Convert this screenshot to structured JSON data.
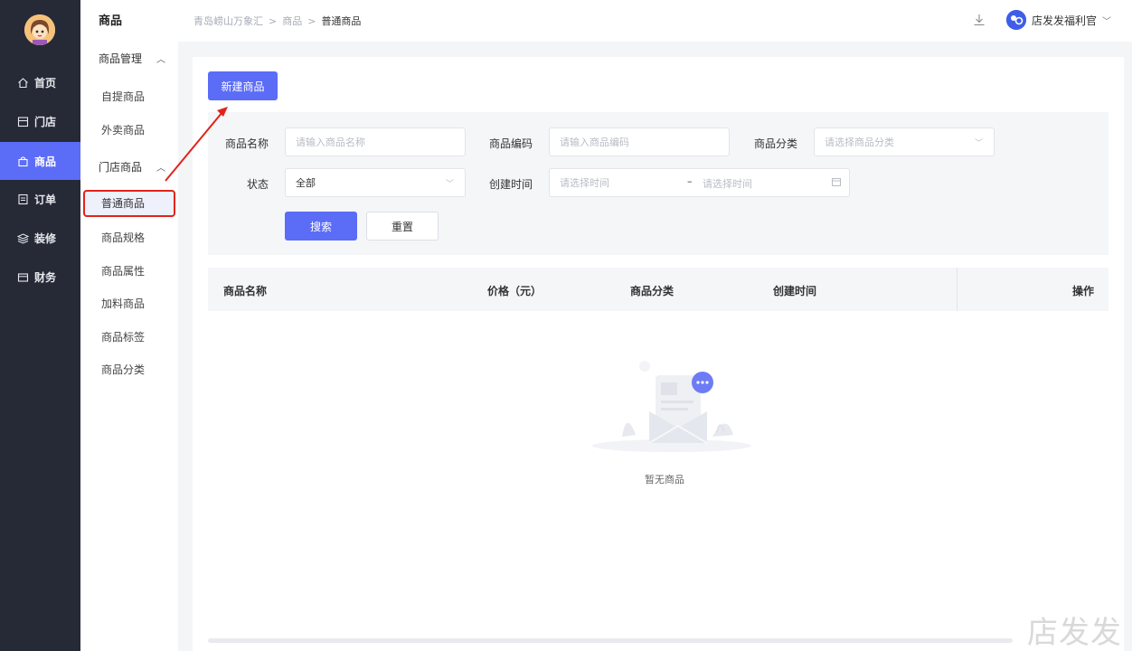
{
  "rail": {
    "items": [
      {
        "label": "首页",
        "icon": "home-icon"
      },
      {
        "label": "门店",
        "icon": "store-icon"
      },
      {
        "label": "商品",
        "icon": "bag-icon",
        "active": true
      },
      {
        "label": "订单",
        "icon": "order-icon"
      },
      {
        "label": "装修",
        "icon": "layers-icon"
      },
      {
        "label": "财务",
        "icon": "wallet-icon"
      }
    ]
  },
  "submenu": {
    "title": "商品",
    "groups": [
      {
        "label": "商品管理",
        "items": [
          "自提商品",
          "外卖商品"
        ]
      },
      {
        "label": "门店商品",
        "items": [
          "普通商品",
          "商品规格",
          "商品属性",
          "加料商品",
          "商品标签",
          "商品分类"
        ]
      }
    ],
    "active_item": "普通商品"
  },
  "header": {
    "breadcrumb": [
      "青岛崂山万象汇",
      "商品",
      "普通商品"
    ],
    "breadcrumb_sep": ">",
    "user_name": "店发发福利官"
  },
  "toolbar": {
    "new_label": "新建商品"
  },
  "filter": {
    "name_label": "商品名称",
    "name_placeholder": "请输入商品名称",
    "code_label": "商品编码",
    "code_placeholder": "请输入商品编码",
    "category_label": "商品分类",
    "category_placeholder": "请选择商品分类",
    "status_label": "状态",
    "status_value": "全部",
    "created_label": "创建时间",
    "created_start_placeholder": "请选择时间",
    "created_sep": "–",
    "created_end_placeholder": "请选择时间",
    "search_label": "搜索",
    "reset_label": "重置"
  },
  "table": {
    "columns": [
      "商品名称",
      "价格（元）",
      "商品分类",
      "创建时间",
      "操作"
    ],
    "empty_text": "暂无商品"
  },
  "watermark": "店发发",
  "colors": {
    "accent": "#5b6cf7",
    "rail": "#262a36",
    "highlight": "#e2231a"
  }
}
